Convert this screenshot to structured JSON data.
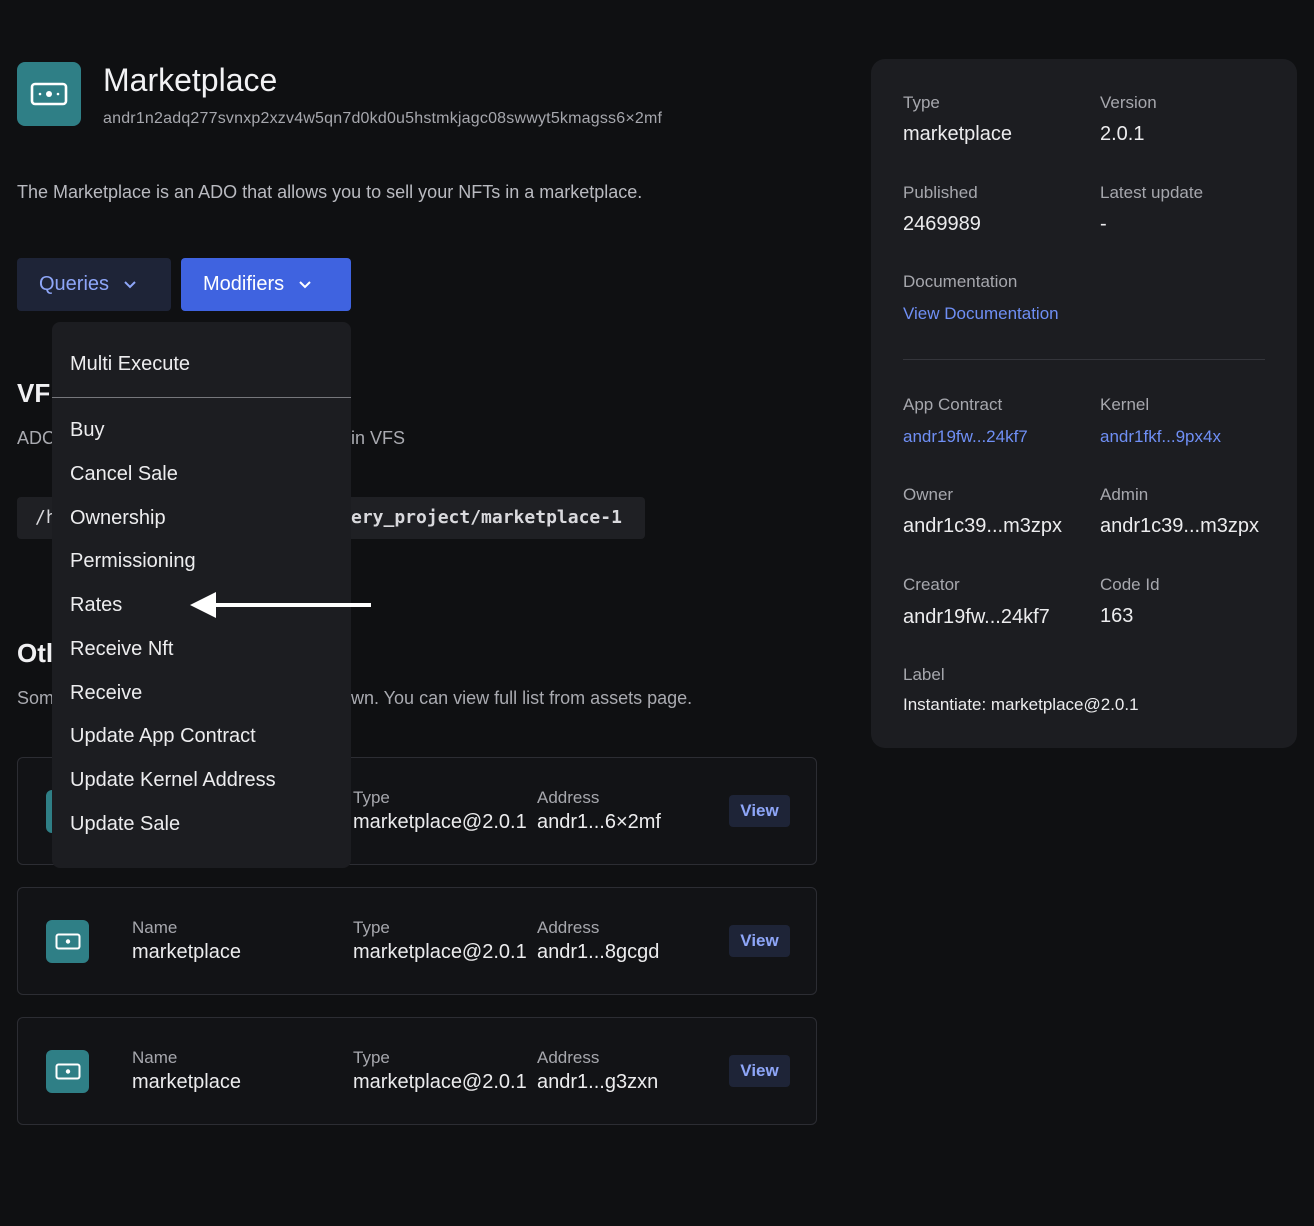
{
  "header": {
    "title": "Marketplace",
    "address": "andr1n2adq277svnxp2xzv4w5qn7d0kd0u5hstmkjagc08swwyt5kmagss6×2mf",
    "icon": "ado-icon"
  },
  "description": "The Marketplace is an ADO that allows you to sell your NFTs in a marketplace.",
  "buttons": {
    "queries": "Queries",
    "modifiers": "Modifiers"
  },
  "dropdown": {
    "items": [
      "Multi Execute",
      "Buy",
      "Cancel Sale",
      "Ownership",
      "Permissioning",
      "Rates",
      "Receive Nft",
      "Receive",
      "Update App Contract",
      "Update Kernel Address",
      "Update Sale"
    ]
  },
  "vfs": {
    "title_visible": "VF",
    "sub_left": "ADC",
    "sub_right": "in VFS",
    "path_left": "/h",
    "path_right": "ery_project/marketplace-1"
  },
  "others": {
    "title_visible": "Otl",
    "sub_left": "Som",
    "sub_right": "wn. You can view full list from assets page.",
    "labels": {
      "name": "Name",
      "type": "Type",
      "address": "Address",
      "view": "View"
    },
    "cards": [
      {
        "name": "",
        "type": "marketplace@2.0.1",
        "address": "andr1...6×2mf"
      },
      {
        "name": "marketplace",
        "type": "marketplace@2.0.1",
        "address": "andr1...8gcgd"
      },
      {
        "name": "marketplace",
        "type": "marketplace@2.0.1",
        "address": "andr1...g3zxn"
      }
    ]
  },
  "panel": {
    "type_label": "Type",
    "type_value": "marketplace",
    "version_label": "Version",
    "version_value": "2.0.1",
    "published_label": "Published",
    "published_value": "2469989",
    "latest_update_label": "Latest update",
    "latest_update_value": "-",
    "documentation_label": "Documentation",
    "documentation_link": "View Documentation",
    "app_contract_label": "App Contract",
    "app_contract_value": "andr19fw...24kf7",
    "kernel_label": "Kernel",
    "kernel_value": "andr1fkf...9px4x",
    "owner_label": "Owner",
    "owner_value": "andr1c39...m3zpx",
    "admin_label": "Admin",
    "admin_value": "andr1c39...m3zpx",
    "creator_label": "Creator",
    "creator_value": "andr19fw...24kf7",
    "code_id_label": "Code Id",
    "code_id_value": "163",
    "label_label": "Label",
    "label_value": "Instantiate: marketplace@2.0.1"
  },
  "colors": {
    "accent": "#3f63e0",
    "link": "#6f8ff5",
    "icon_bg": "#2f7f86",
    "panel_bg": "#1c1d21"
  }
}
